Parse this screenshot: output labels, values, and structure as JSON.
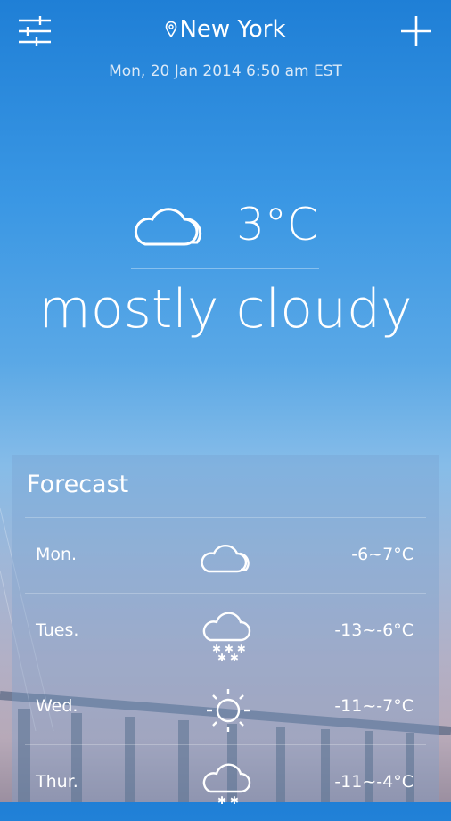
{
  "header": {
    "location": "New York",
    "datetime": "Mon, 20 Jan 2014 6:50 am EST",
    "settings_icon": "sliders-icon",
    "add_icon": "plus-icon",
    "location_icon": "location-pin-icon"
  },
  "current": {
    "icon": "cloudy-icon",
    "temperature": "3°C",
    "condition": "mostly cloudy"
  },
  "forecast": {
    "title": "Forecast",
    "days": [
      {
        "day": "Mon.",
        "icon": "cloudy-icon",
        "range": "-6~7°C"
      },
      {
        "day": "Tues.",
        "icon": "snow-icon",
        "range": "-13~-6°C"
      },
      {
        "day": "Wed.",
        "icon": "sunny-icon",
        "range": "-11~-7°C"
      },
      {
        "day": "Thur.",
        "icon": "snow-icon",
        "range": "-11~-4°C"
      }
    ]
  }
}
